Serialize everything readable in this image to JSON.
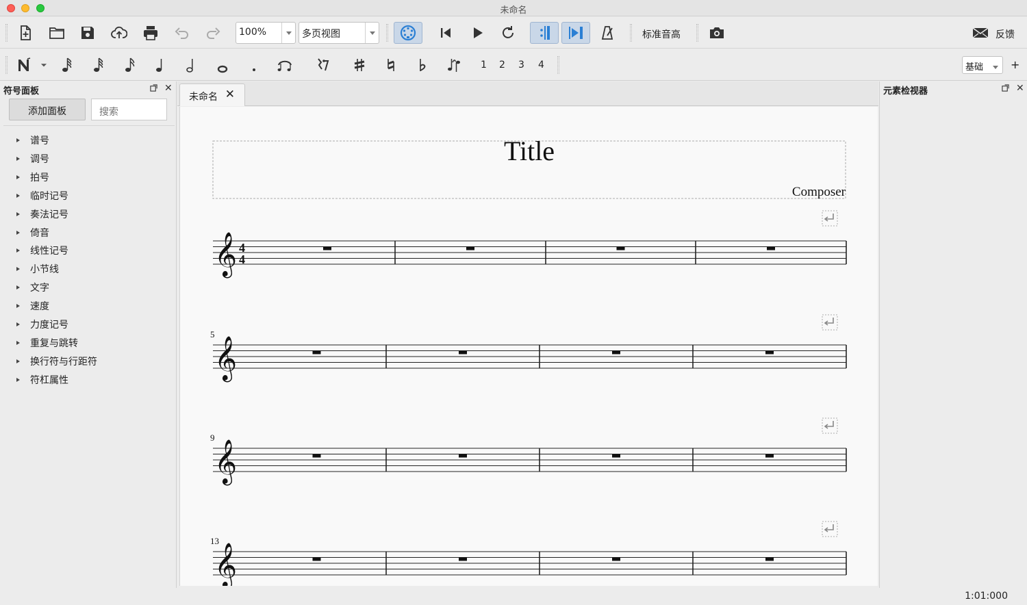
{
  "window": {
    "title": "未命名"
  },
  "toolbar": {
    "zoom": "100%",
    "view_mode": "多页视图",
    "concert_pitch": "标准音高",
    "feedback": "反馈"
  },
  "note_input": {
    "voices": [
      "1",
      "2",
      "3",
      "4"
    ],
    "workspace": "基础",
    "add_label": "+"
  },
  "palette": {
    "title": "符号面板",
    "add_button": "添加面板",
    "search_placeholder": "搜索",
    "items": [
      "谱号",
      "调号",
      "拍号",
      "临时记号",
      "奏法记号",
      "倚音",
      "线性记号",
      "小节线",
      "文字",
      "速度",
      "力度记号",
      "重复与跳转",
      "换行符与行距符",
      "符杠属性"
    ]
  },
  "tab": {
    "label": "未命名"
  },
  "score": {
    "title": "Title",
    "composer": "Composer",
    "time_signature": {
      "numerator": "4",
      "denominator": "4"
    },
    "systems": [
      {
        "measure_number": ""
      },
      {
        "measure_number": "5"
      },
      {
        "measure_number": "9"
      },
      {
        "measure_number": "13"
      }
    ]
  },
  "inspector": {
    "title": "元素检视器"
  },
  "status": {
    "position": "1:01:000"
  }
}
